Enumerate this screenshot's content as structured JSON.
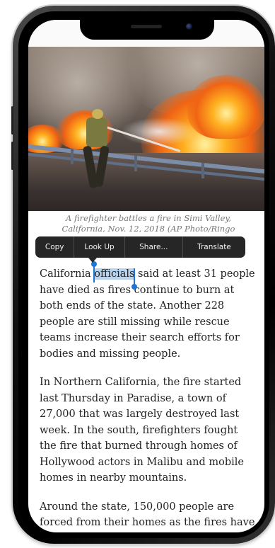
{
  "article": {
    "caption": "A firefighter battles a fire in Simi Valley, California, Nov. 12, 2018 (AP Photo/Ringo",
    "p1_before": "California ",
    "p1_selected": "officials",
    "p1_after": " said at least 31 people have died as fires continue to burn at both ends of the state. Another 228 people are still missing while rescue teams increase their search efforts for bodies and missing people.",
    "p2": "In Northern California, the fire started last Thursday in Paradise, a town of 27,000 that was largely destroyed last week. In the south, firefighters fought the fire that burned through homes of Hollywood actors in Malibu and mobile homes in nearby mountains.",
    "p3": "Around the state, 150,000 people are forced from their homes as the fires have"
  },
  "context_menu": {
    "items": [
      "Copy",
      "Look Up",
      "Share...",
      "Translate"
    ]
  },
  "colors": {
    "selection": "#b7d3ee",
    "selection_handle": "#1f76d2",
    "menu_background": "#262626"
  }
}
